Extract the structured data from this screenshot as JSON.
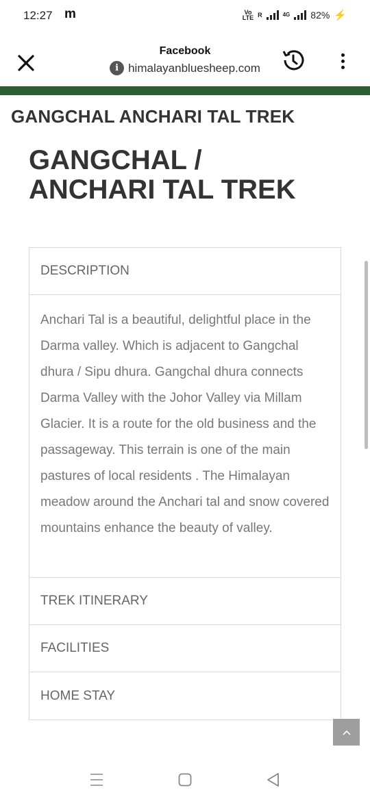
{
  "status_bar": {
    "time": "12:27",
    "notification_app": "m",
    "volte_label": "Vo\nLTE",
    "network_label": "R",
    "net_type": "4G",
    "battery": "82%"
  },
  "toolbar": {
    "page_title": "Facebook",
    "url": "himalayanbluesheep.com",
    "close_icon": "close-icon",
    "info_icon_glyph": "i"
  },
  "colors": {
    "accent_bar": "#2f5d33",
    "charging": "#2fb36a"
  },
  "page": {
    "site_heading": "GANGCHAL ANCHARI TAL TREK",
    "main_heading": "GANGCHAL / ANCHARI TAL TREK"
  },
  "accordion": {
    "sections": [
      {
        "label": "DESCRIPTION"
      },
      {
        "label": "TREK ITINERARY"
      },
      {
        "label": "FACILITIES"
      },
      {
        "label": "HOME STAY"
      }
    ],
    "description_text": "Anchari Tal is a beautiful, delightful place in the Darma valley. Which is adjacent to Gangchal dhura / Sipu dhura. Gangchal dhura connects Darma Valley with the Johor Valley via Millam Glacier. It is a route for the old business and the passageway. This terrain is one of the main pastures of local residents . The Himalayan meadow around the Anchari tal and snow covered mountains enhance the beauty of valley."
  },
  "icons": {
    "back_to_top": "chevron-up-icon",
    "nav_recent": "recent-apps-icon",
    "nav_home": "home-icon",
    "nav_back": "back-icon"
  }
}
